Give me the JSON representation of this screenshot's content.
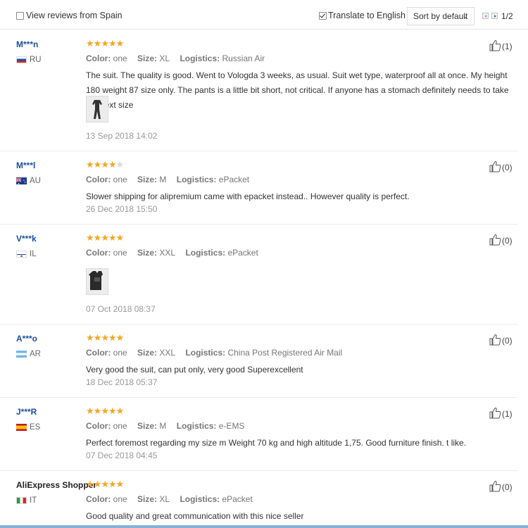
{
  "toolbar": {
    "view_reviews_label": "View reviews from Spain",
    "view_reviews_checked": false,
    "translate_label": "Translate to English",
    "translate_checked": true,
    "sort_label": "Sort by default",
    "page_info": "1/2"
  },
  "colors": {
    "star": "#f5a623",
    "star_off": "#d9d9d9",
    "name": "#1a4f9c"
  },
  "reviews": [
    {
      "name": "M***n",
      "country": "RU",
      "stars": 5,
      "color": "one",
      "size": "XL",
      "logistics": "Russian Air",
      "text": "The suit. The quality is good. Went to Vologda 3 weeks, as usual. Suit wet type, waterproof all at once. My height 180 weight 87 size only. The pants is a little bit short, not critical. If anyone has a stomach definitely needs to take the next size",
      "date": "13 Sep 2018 14:02",
      "likes": "(1)"
    },
    {
      "name": "M***l",
      "country": "AU",
      "stars": 4,
      "color": "one",
      "size": "M",
      "logistics": "ePacket",
      "text": "Slower shipping for alipremium came with epacket instead.. However quality is perfect.",
      "date": "26 Dec 2018 15:50",
      "likes": "(0)"
    },
    {
      "name": "V***k",
      "country": "IL",
      "stars": 5,
      "color": "one",
      "size": "XXL",
      "logistics": "ePacket",
      "text": "",
      "date": "07 Oct 2018 08:37",
      "likes": "(0)"
    },
    {
      "name": "A***o",
      "country": "AR",
      "stars": 5,
      "color": "one",
      "size": "XXL",
      "logistics": "China Post Registered Air Mail",
      "text": "Very good the suit, can put only, very good Superexcellent",
      "date": "18 Dec 2018 05:37",
      "likes": "(0)"
    },
    {
      "name": "J***R",
      "country": "ES",
      "stars": 5,
      "color": "one",
      "size": "M",
      "logistics": "e-EMS",
      "text": "Perfect foremost regarding my size m Weight 70 kg and high altitude 1,75. Good furniture finish. t like.",
      "date": "07 Dec 2018 04:45",
      "likes": "(1)"
    },
    {
      "name": "AliExpress Shopper",
      "country": "IT",
      "stars": 5,
      "color": "one",
      "size": "XL",
      "logistics": "ePacket",
      "text": "Good quality and great communication with this nice seller",
      "date": "",
      "likes": "(0)"
    }
  ],
  "labels": {
    "color": "Color:",
    "size": "Size:",
    "logistics": "Logistics:"
  }
}
